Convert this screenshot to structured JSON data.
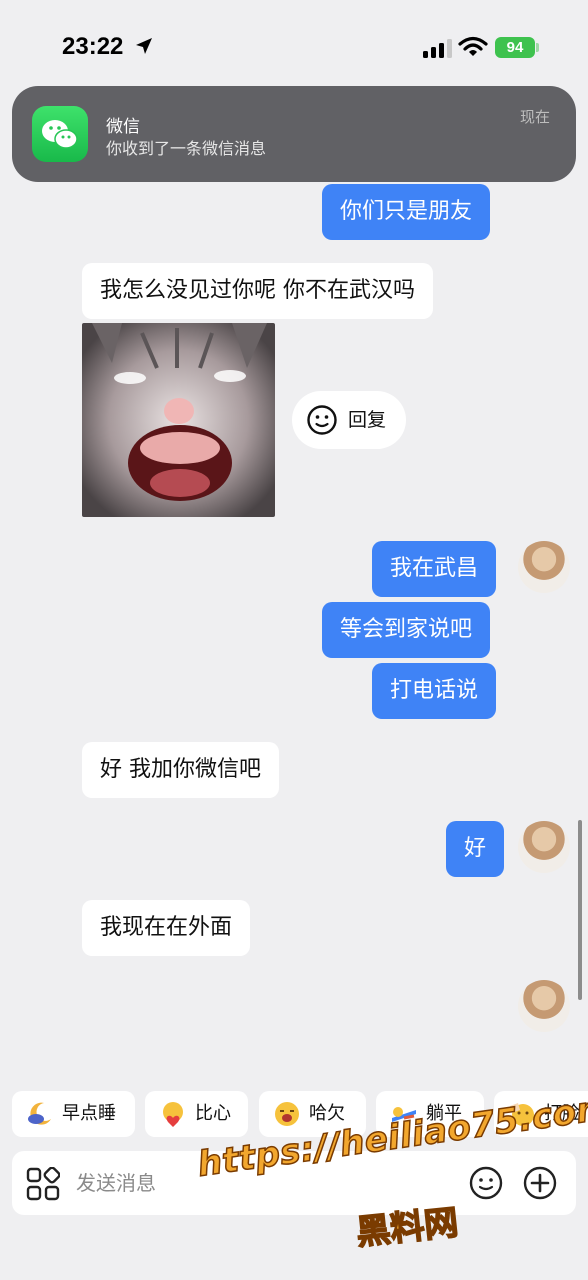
{
  "status_bar": {
    "time": "23:22",
    "battery": "94"
  },
  "notification": {
    "app_name": "微信",
    "message": "你收到了一条微信消息",
    "time": "现在",
    "icon": "wechat-icon"
  },
  "messages": [
    {
      "side": "out",
      "text": "你们只是朋友"
    },
    {
      "side": "in",
      "text": "我怎么没见过你呢 你不在武汉吗"
    },
    {
      "side": "in",
      "type": "sticker",
      "icon": "screaming-cat-sticker"
    },
    {
      "side": "out",
      "text": "我在武昌"
    },
    {
      "side": "out",
      "text": "等会到家说吧"
    },
    {
      "side": "out",
      "text": "打电话说"
    },
    {
      "side": "in",
      "text": "好 我加你微信吧"
    },
    {
      "side": "out",
      "text": "好"
    },
    {
      "side": "in",
      "text": "我现在在外面"
    }
  ],
  "reply_button": {
    "label": "回复",
    "icon": "smile-face-icon"
  },
  "quick_replies": [
    {
      "label": "早点睡",
      "icon": "moon-sleep-emoji"
    },
    {
      "label": "比心",
      "icon": "heart-hands-emoji"
    },
    {
      "label": "哈欠",
      "icon": "yawn-emoji"
    },
    {
      "label": "躺平",
      "icon": "lie-flat-emoji"
    },
    {
      "label": "打脸",
      "icon": "slap-face-emoji"
    }
  ],
  "composer": {
    "placeholder": "发送消息"
  },
  "watermark": {
    "url": "https://heiliao75.com",
    "text": "黑料网"
  },
  "colors": {
    "background": "#efeff1",
    "outgoing_bubble": "#3f83f6",
    "incoming_bubble": "#ffffff",
    "battery": "#3ec24e"
  }
}
